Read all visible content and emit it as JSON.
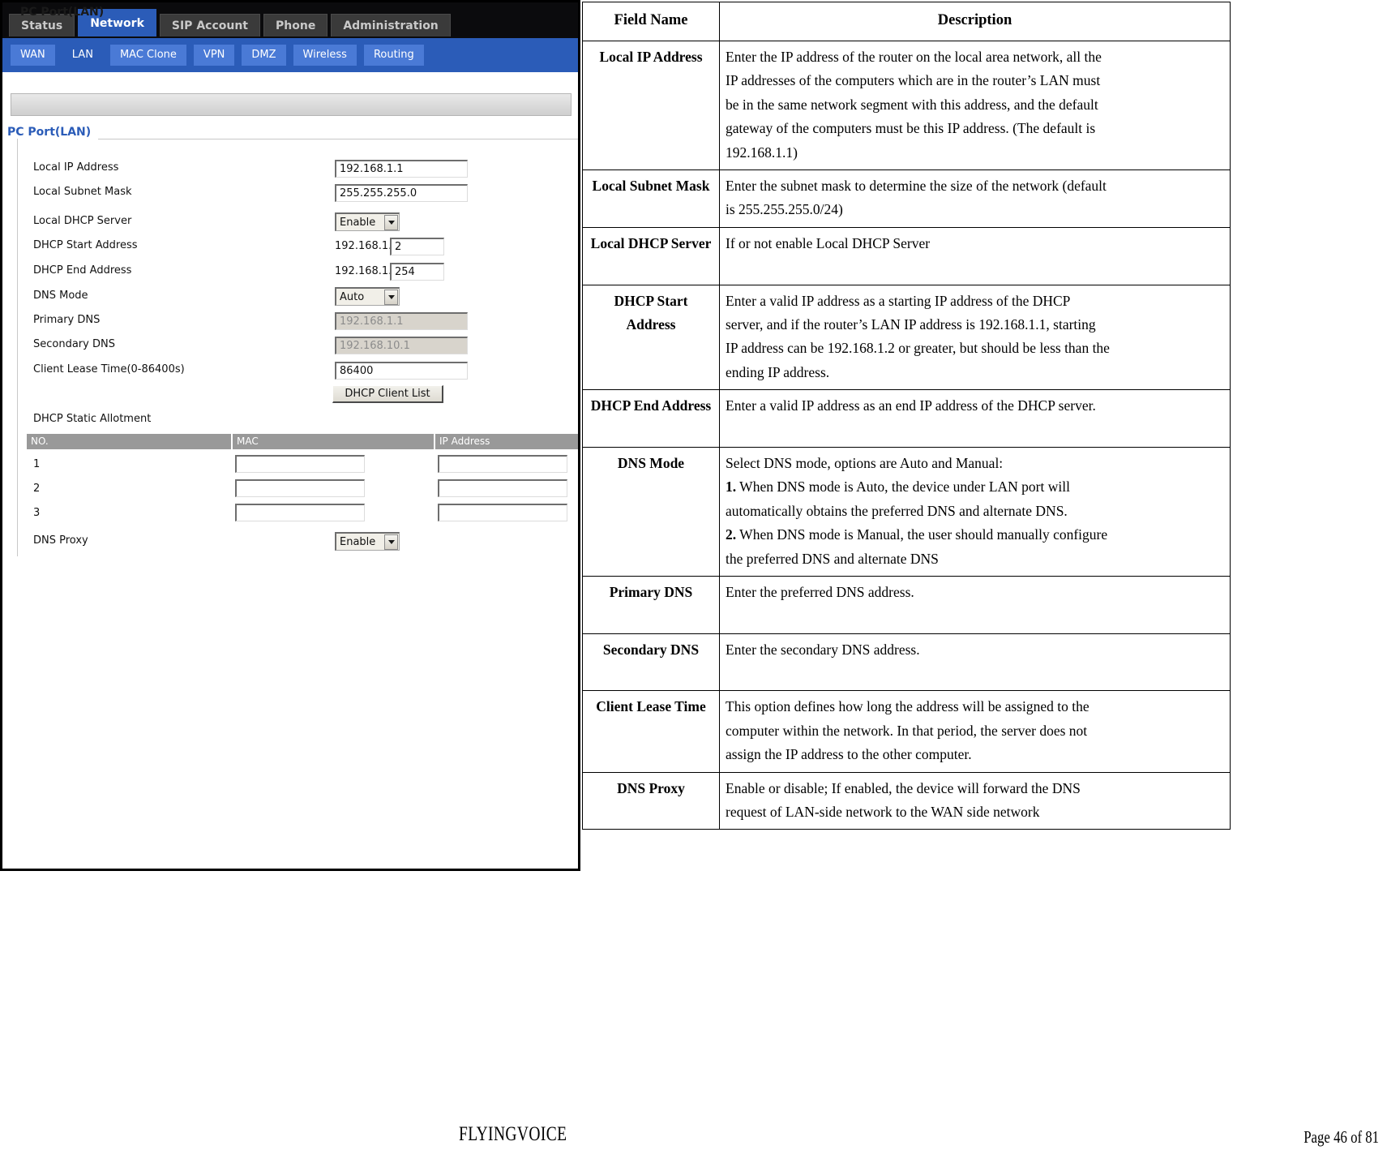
{
  "screenshot": {
    "browser_tabs": [
      {
        "label": "Status",
        "active": false
      },
      {
        "label": "Network",
        "active": true
      },
      {
        "label": "SIP Account",
        "active": false
      },
      {
        "label": "Phone",
        "active": false
      },
      {
        "label": "Administration",
        "active": false
      }
    ],
    "sub_tabs": [
      {
        "label": "WAN",
        "active": false
      },
      {
        "label": "LAN",
        "active": true
      },
      {
        "label": "MAC Clone",
        "active": false
      },
      {
        "label": "VPN",
        "active": false
      },
      {
        "label": "DMZ",
        "active": false
      },
      {
        "label": "Wireless",
        "active": false
      },
      {
        "label": "Routing",
        "active": false
      }
    ],
    "page_band_title": "PC Port(LAN)",
    "fieldset_legend": "PC Port(LAN)",
    "fields": {
      "local_ip_address": {
        "label": "Local IP Address",
        "value": "192.168.1.1"
      },
      "local_subnet_mask": {
        "label": "Local Subnet Mask",
        "value": "255.255.255.0"
      },
      "local_dhcp_server": {
        "label": "Local DHCP Server",
        "value": "Enable"
      },
      "dhcp_start_address": {
        "label": "DHCP Start Address",
        "prefix": "192.168.1.",
        "value": "2"
      },
      "dhcp_end_address": {
        "label": "DHCP End Address",
        "prefix": "192.168.1.",
        "value": "254"
      },
      "dns_mode": {
        "label": "DNS Mode",
        "value": "Auto"
      },
      "primary_dns": {
        "label": "Primary DNS",
        "value": "192.168.1.1"
      },
      "secondary_dns": {
        "label": "Secondary DNS",
        "value": "192.168.10.1"
      },
      "client_lease_time": {
        "label": "Client Lease Time(0-86400s)",
        "value": "86400"
      },
      "dns_proxy": {
        "label": "DNS Proxy",
        "value": "Enable"
      }
    },
    "dhcp_client_list_button": "DHCP Client List",
    "static_allotment": {
      "title": "DHCP Static Allotment",
      "columns": [
        "NO.",
        "MAC",
        "IP Address"
      ],
      "rows": [
        {
          "no": "1",
          "mac": "",
          "ip": ""
        },
        {
          "no": "2",
          "mac": "",
          "ip": ""
        },
        {
          "no": "3",
          "mac": "",
          "ip": ""
        }
      ]
    }
  },
  "table": {
    "headers": {
      "field_name": "Field Name",
      "description": "Description"
    },
    "rows": [
      {
        "field": "Local IP Address",
        "lines": [
          "Enter the IP address of the router on the local area network, all the",
          "IP addresses of the computers which are in the router’s LAN must",
          "be in the same network segment with this address, and the default",
          "gateway of the computers must be this IP address. (The default is",
          "192.168.1.1)"
        ]
      },
      {
        "field": "Local Subnet Mask",
        "lines": [
          "Enter the subnet mask to determine the size of the network (default",
          "is 255.255.255.0/24)"
        ]
      },
      {
        "field": "Local DHCP Server",
        "lines": [
          "If or not enable Local DHCP Server",
          ""
        ]
      },
      {
        "field": "DHCP Start Address",
        "lines": [
          "Enter a valid IP address as a starting IP address of the DHCP",
          "server, and if the router’s LAN IP address is 192.168.1.1, starting",
          "IP address can be 192.168.1.2 or greater, but should be less than the",
          "ending IP address."
        ]
      },
      {
        "field": "DHCP End Address",
        "lines": [
          "Enter a valid IP address as an end IP address of the DHCP server.",
          ""
        ]
      },
      {
        "field": "DNS Mode",
        "lines": [
          "Select DNS mode, options are Auto and Manual:",
          "1. When DNS mode is Auto, the device under LAN port will",
          "automatically obtains the preferred DNS and alternate DNS.",
          "2. When DNS mode is Manual, the user should manually configure",
          "the preferred DNS and alternate DNS"
        ],
        "bold_prefixes": {
          "1": "1.",
          "3": "2."
        }
      },
      {
        "field": "Primary DNS",
        "lines": [
          "Enter the preferred DNS address.",
          ""
        ]
      },
      {
        "field": "Secondary DNS",
        "lines": [
          "Enter the secondary DNS address.",
          ""
        ]
      },
      {
        "field": "Client Lease Time",
        "lines": [
          "This option defines how long the address will be assigned to the",
          "computer within the network. In that period, the server does not",
          "assign the IP address to the other computer."
        ]
      },
      {
        "field": "DNS Proxy",
        "lines": [
          "Enable or disable; If enabled, the device will forward the DNS",
          "request of LAN-side network to the WAN side network"
        ]
      }
    ]
  },
  "footer": {
    "brand": "FLYINGVOICE",
    "page_text": "Page  46  of  81"
  }
}
